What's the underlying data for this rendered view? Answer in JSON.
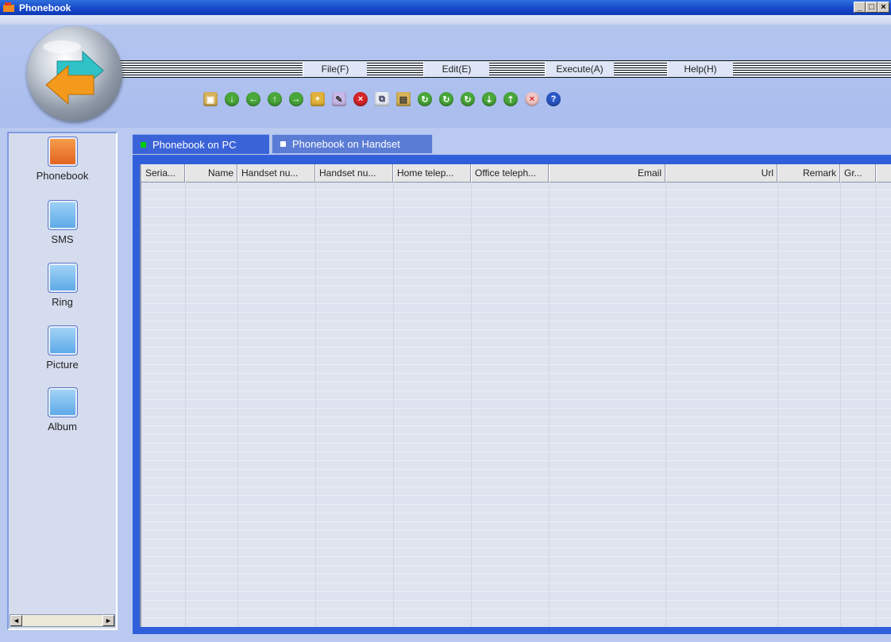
{
  "window": {
    "title": "Phonebook",
    "controls": [
      "_",
      "□",
      "×"
    ]
  },
  "menu": [
    {
      "label": "File(F)"
    },
    {
      "label": "Edit(E)"
    },
    {
      "label": "Execute(A)"
    },
    {
      "label": "Help(H)"
    }
  ],
  "toolbar_icons": [
    "contact-card-icon",
    "download-icon",
    "back-icon",
    "upload-icon",
    "forward-icon",
    "new-folder-icon",
    "edit-icon",
    "delete-icon",
    "copy-icon",
    "paste-icon",
    "sync-icon",
    "sync-phone-icon",
    "sync-upload-icon",
    "import-icon",
    "export-icon",
    "cancel-icon",
    "help-icon"
  ],
  "sidebar": {
    "items": [
      {
        "label": "Phonebook",
        "icon": "phonebook-icon"
      },
      {
        "label": "SMS",
        "icon": "sms-icon"
      },
      {
        "label": "Ring",
        "icon": "ring-icon"
      },
      {
        "label": "Picture",
        "icon": "picture-icon"
      },
      {
        "label": "Album",
        "icon": "album-icon"
      }
    ],
    "scroll_left": "◄",
    "scroll_right": "►"
  },
  "tabs": [
    {
      "label": "Phonebook on PC",
      "active": true
    },
    {
      "label": "Phonebook on Handset",
      "active": false
    }
  ],
  "table": {
    "columns": [
      {
        "label": "Seria..."
      },
      {
        "label": "Name"
      },
      {
        "label": "Handset nu..."
      },
      {
        "label": "Handset nu..."
      },
      {
        "label": "Home telep..."
      },
      {
        "label": "Office teleph..."
      },
      {
        "label": "Email"
      },
      {
        "label": "Url"
      },
      {
        "label": "Remark"
      },
      {
        "label": "Gr..."
      }
    ]
  },
  "colors": {
    "title_bar": "#1546c6",
    "header_bg": "#b4c5ee",
    "panel_blue": "#2f5fdb",
    "active_tab_marker": "#00cc00",
    "inactive_tab_marker": "#ffffff"
  }
}
